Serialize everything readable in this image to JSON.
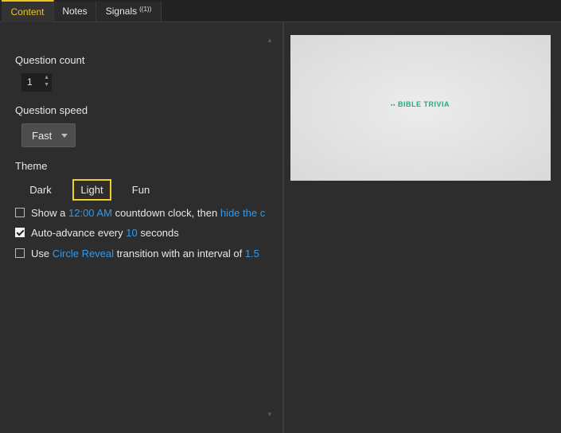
{
  "tabs": [
    {
      "label": "Content"
    },
    {
      "label": "Notes"
    },
    {
      "label": "Signals",
      "badge": "((1))"
    }
  ],
  "question_count": {
    "label": "Question count",
    "value": "1"
  },
  "question_speed": {
    "label": "Question speed",
    "value": "Fast"
  },
  "theme": {
    "label": "Theme",
    "options": [
      "Dark",
      "Light",
      "Fun"
    ],
    "selected": "Light"
  },
  "options": {
    "countdown": {
      "checked": false,
      "pre": "Show a",
      "time": "12:00 AM",
      "mid": "countdown clock, then",
      "action": "hide the c"
    },
    "autoadvance": {
      "checked": true,
      "pre": "Auto-advance every",
      "seconds": "10",
      "post": "seconds"
    },
    "transition": {
      "checked": false,
      "pre": "Use",
      "effect": "Circle Reveal",
      "mid": "transition with an interval of",
      "interval": "1.5"
    }
  },
  "preview": {
    "logo_text": "BIBLE TRIVIA"
  },
  "colors": {
    "accent": "#f0c419",
    "link": "#2e9bf0",
    "logo": "#2aa876"
  }
}
